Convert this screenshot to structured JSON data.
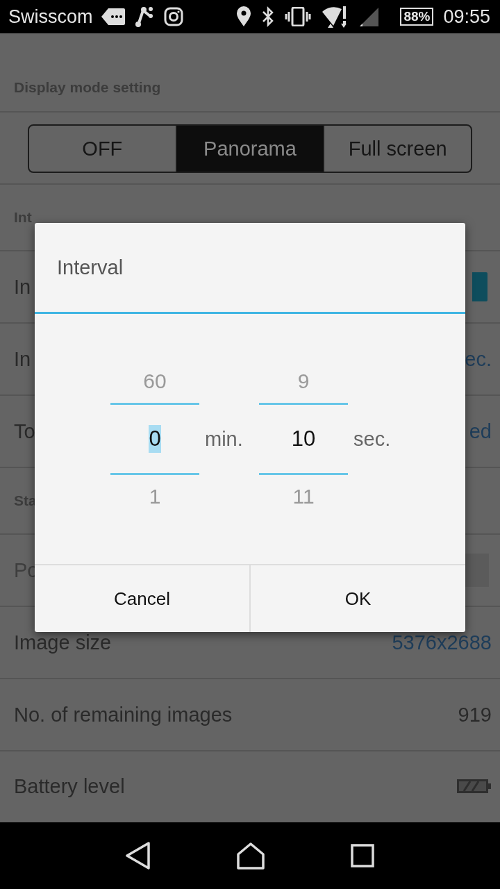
{
  "status_bar": {
    "carrier": "Swisscom",
    "battery": "88%",
    "time": "09:55"
  },
  "display_mode": {
    "header": "Display mode setting",
    "options": [
      {
        "label": "OFF",
        "selected": false
      },
      {
        "label": "Panorama",
        "selected": true
      },
      {
        "label": "Full screen",
        "selected": false
      }
    ]
  },
  "interval_section": {
    "header": "Int",
    "rows": [
      {
        "kind": "toggle",
        "label": "In",
        "on": true,
        "disabled": false
      },
      {
        "kind": "value",
        "label": "In",
        "value": "ec.",
        "accent": true,
        "disabled": false
      },
      {
        "kind": "value",
        "label": "To",
        "value": "ed",
        "accent": true,
        "disabled": false
      }
    ]
  },
  "status_section": {
    "header": "Sta",
    "rows": [
      {
        "kind": "button",
        "label": "Po",
        "disabled": true
      },
      {
        "kind": "value",
        "label": "Image size",
        "value": "5376x2688",
        "accent": true,
        "disabled": false
      },
      {
        "kind": "value",
        "label": "No. of remaining images",
        "value": "919",
        "accent": false,
        "disabled": false
      },
      {
        "kind": "battery",
        "label": "Battery level",
        "disabled": false
      }
    ]
  },
  "dialog": {
    "title": "Interval",
    "pickers": [
      {
        "above": "60",
        "value": "0",
        "below": "1",
        "unit": "min.",
        "selected": true
      },
      {
        "above": "9",
        "value": "10",
        "below": "11",
        "unit": "sec.",
        "selected": false
      }
    ],
    "buttons": [
      "Cancel",
      "OK"
    ]
  }
}
